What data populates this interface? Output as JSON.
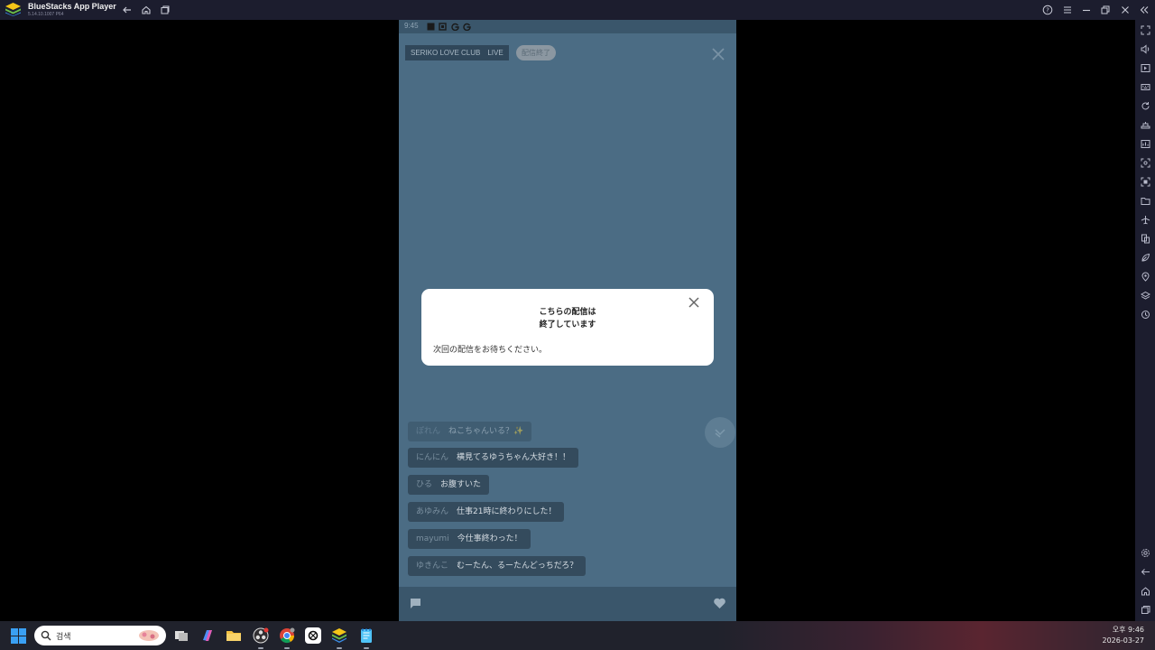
{
  "titlebar": {
    "app_title": "BlueStacks App Player",
    "app_version": "5.14.10.1007  P64"
  },
  "phone": {
    "status_time": "9:45",
    "channel_label": "SERIKO LOVE CLUB　LIVE",
    "ended_badge": "配信終了"
  },
  "comments": [
    {
      "user": "ぽれん",
      "msg": "ねこちゃんいる？✨"
    },
    {
      "user": "にんにん",
      "msg": "横見てるゆうちゃん大好き！！"
    },
    {
      "user": "ひる",
      "msg": "お腹すいた"
    },
    {
      "user": "あゆみん",
      "msg": "仕事21時に終わりにした！"
    },
    {
      "user": "mayumi",
      "msg": "今仕事終わった！"
    },
    {
      "user": "ゆきんこ",
      "msg": "むーたん、るーたんどっちだろ？"
    }
  ],
  "modal": {
    "title_line1": "こちらの配信は",
    "title_line2": "終了しています",
    "body": "次回の配信をお待ちください。"
  },
  "taskbar": {
    "search_placeholder": "검색",
    "clock_time": "오후 9:46",
    "clock_date": "2026-03-27"
  },
  "colors": {
    "bluestacks_chrome": "#1c1d2e",
    "phone_background": "#4b6c84",
    "comment_bubble": "#344b5d",
    "modal_background": "#ffffff"
  },
  "icons": {
    "titlebar_left": [
      "back-icon",
      "home-icon",
      "multi-instance-icon"
    ],
    "titlebar_right": [
      "help-icon",
      "menu-icon",
      "minimize-icon",
      "restore-icon",
      "close-icon",
      "collapse-sidebar-icon"
    ],
    "sidebar": [
      "fullscreen-icon",
      "volume-icon",
      "media-icon",
      "keyboard-icon",
      "rotate-icon",
      "shake-icon",
      "performance-icon",
      "screenshot-icon",
      "record-icon",
      "folder-icon",
      "airplane-icon",
      "multi-instance-icon",
      "eco-mode-icon",
      "location-icon",
      "layers-icon",
      "sync-icon",
      "settings-icon",
      "back-icon",
      "home-icon",
      "recents-icon"
    ]
  }
}
